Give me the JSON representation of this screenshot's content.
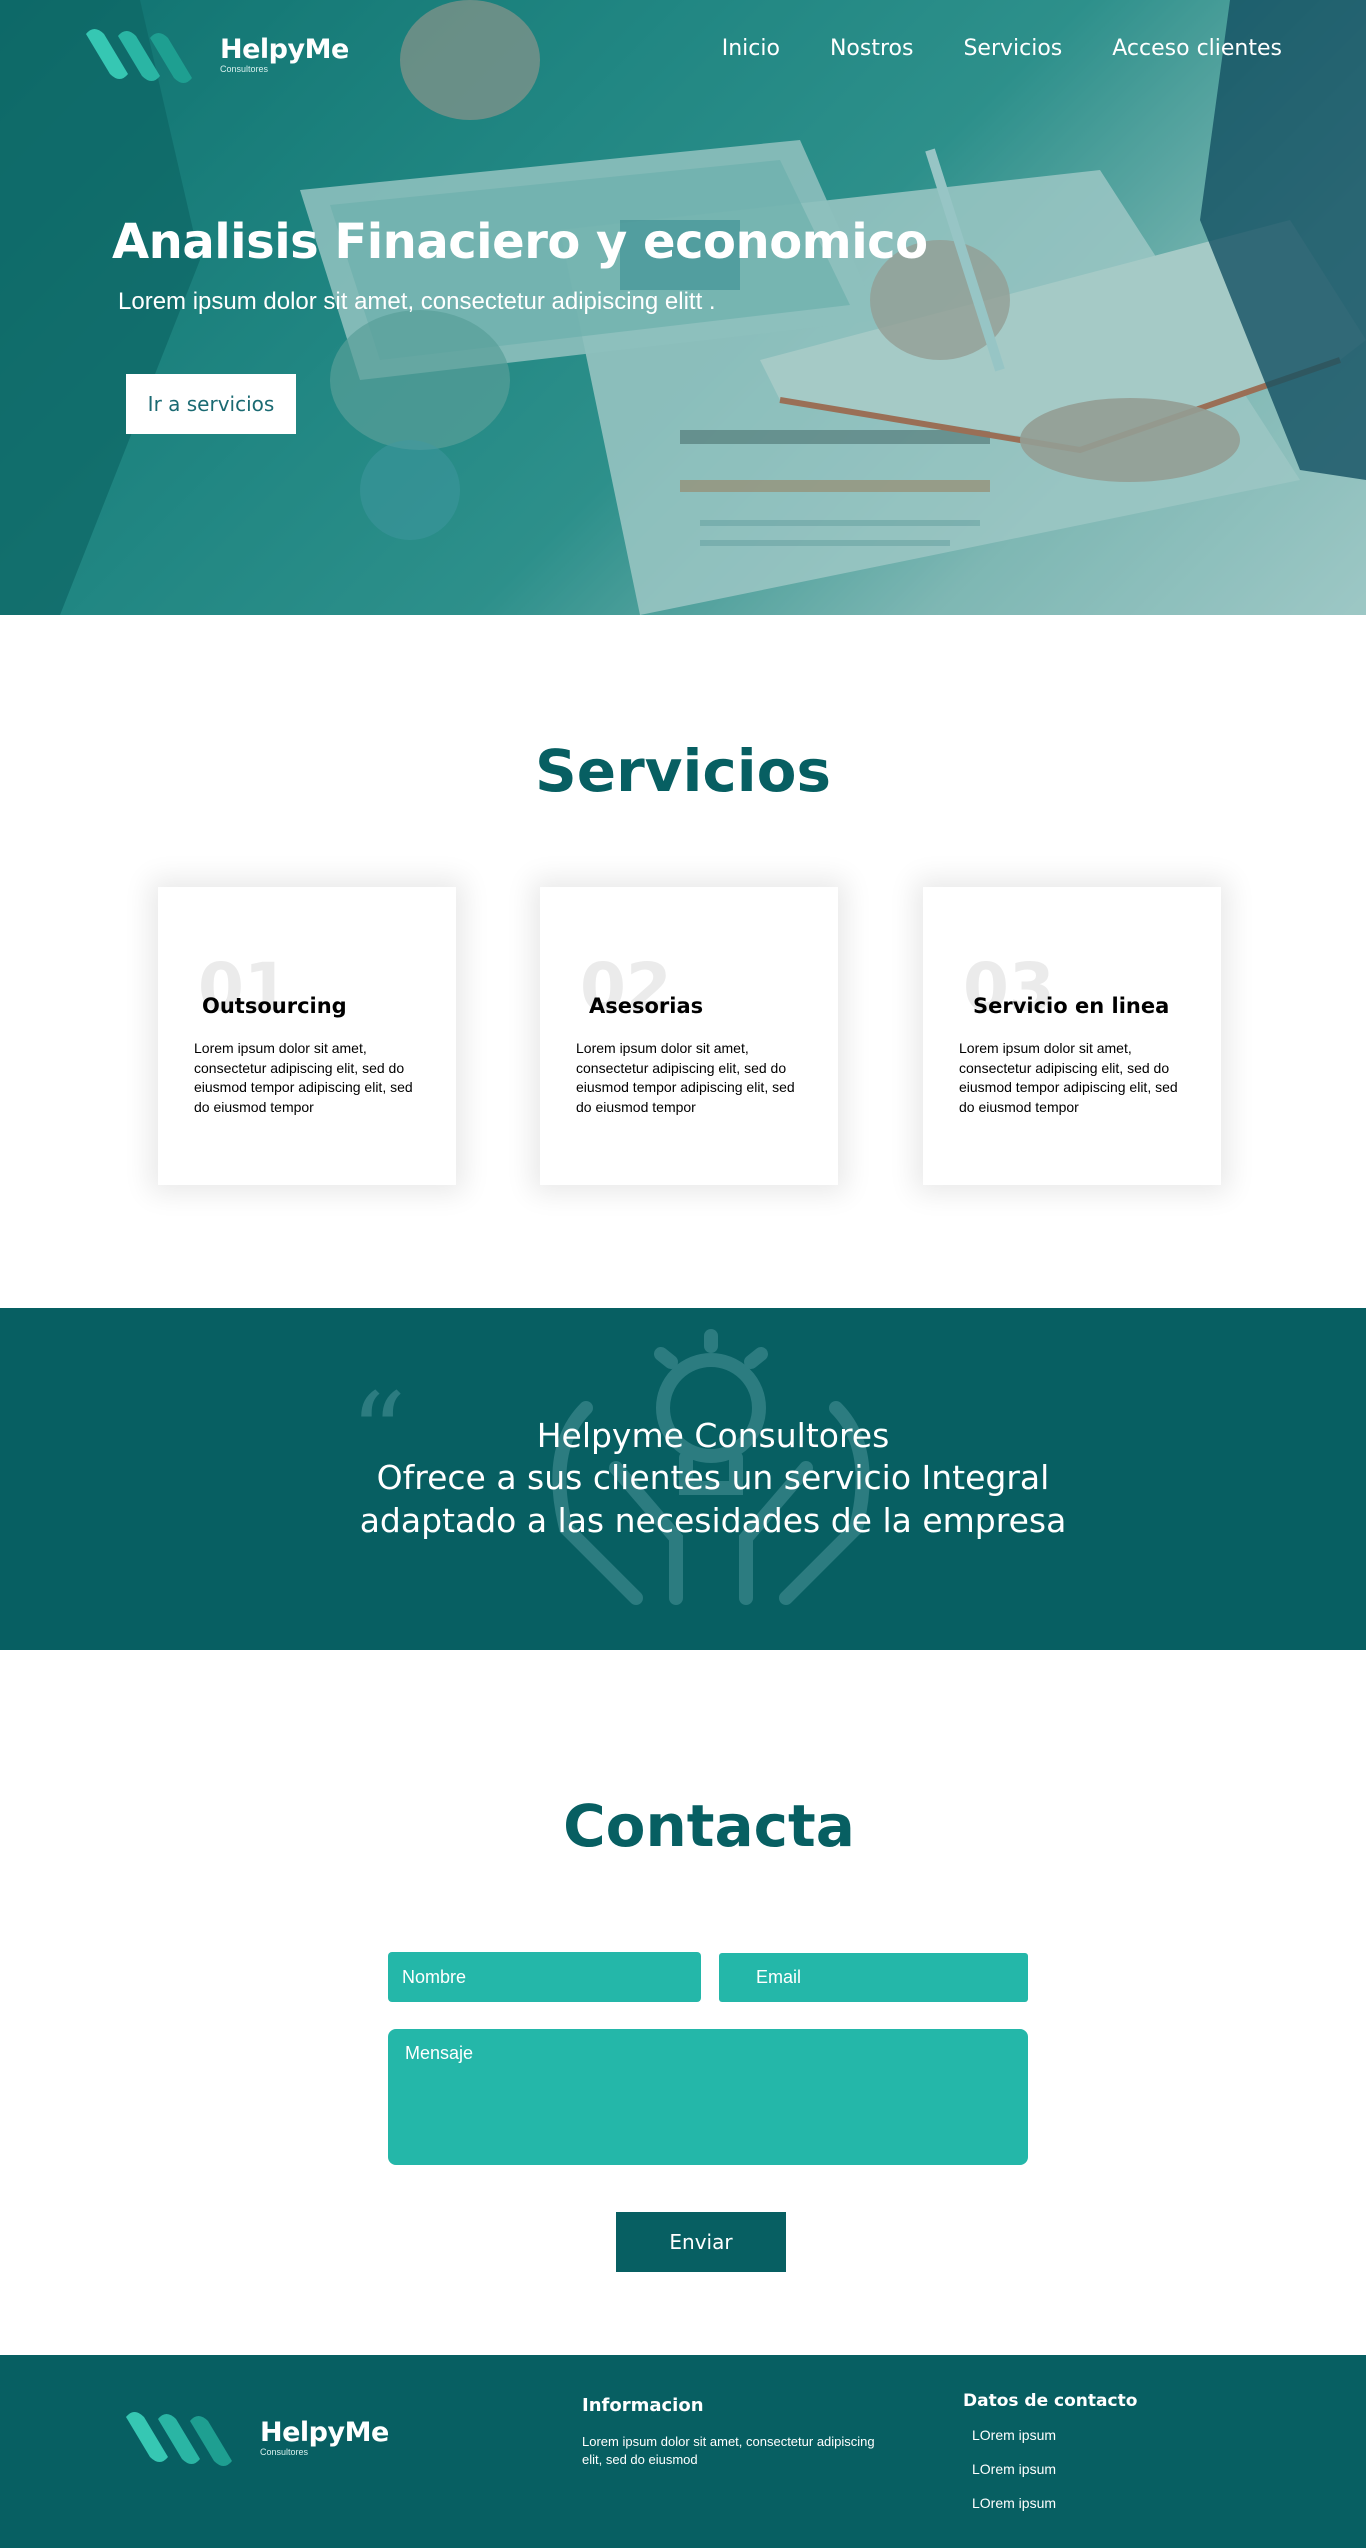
{
  "brand": {
    "name": "HelpyMe",
    "tagline": "Consultores"
  },
  "nav": {
    "items": [
      "Inicio",
      "Nostros",
      "Servicios",
      "Acceso clientes"
    ]
  },
  "hero": {
    "title": "Analisis Finaciero y economico",
    "subtitle": "Lorem ipsum dolor sit amet, consectetur adipiscing elitt .",
    "button": "Ir a servicios"
  },
  "services": {
    "title": "Servicios",
    "cards": [
      {
        "number": "01",
        "title": "Outsourcing",
        "text": "Lorem ipsum dolor sit amet, consectetur adipiscing elit, sed do eiusmod tempor adipiscing elit, sed do eiusmod tempor"
      },
      {
        "number": "02",
        "title": "Asesorias",
        "text": "Lorem ipsum dolor sit amet, consectetur adipiscing elit, sed do eiusmod tempor adipiscing elit, sed do eiusmod tempor"
      },
      {
        "number": "03",
        "title": "Servicio en linea",
        "text": "Lorem ipsum dolor sit amet, consectetur adipiscing elit, sed do eiusmod tempor adipiscing elit, sed do eiusmod tempor"
      }
    ]
  },
  "quote": {
    "line1": "Helpyme Consultores",
    "line2": "Ofrece a sus clientes un servicio Integral",
    "line3": "adaptado a las necesidades de la empresa",
    "icons": [
      "quote-mark-icon",
      "idea-hands-icon"
    ]
  },
  "contact": {
    "title": "Contacta",
    "nombre_placeholder": "Nombre",
    "email_placeholder": "Email",
    "mensaje_placeholder": "Mensaje",
    "send": "Enviar"
  },
  "footer": {
    "info_title": "Informacion",
    "info_text": "Lorem ipsum dolor sit amet, consectetur adipiscing elit, sed do eiusmod",
    "contact_title": "Datos de contacto",
    "contact_items": [
      "LOrem ipsum",
      "LOrem ipsum",
      "LOrem ipsum"
    ]
  },
  "colors": {
    "primary": "#075f62",
    "accent": "#24b7a9",
    "white": "#ffffff"
  }
}
